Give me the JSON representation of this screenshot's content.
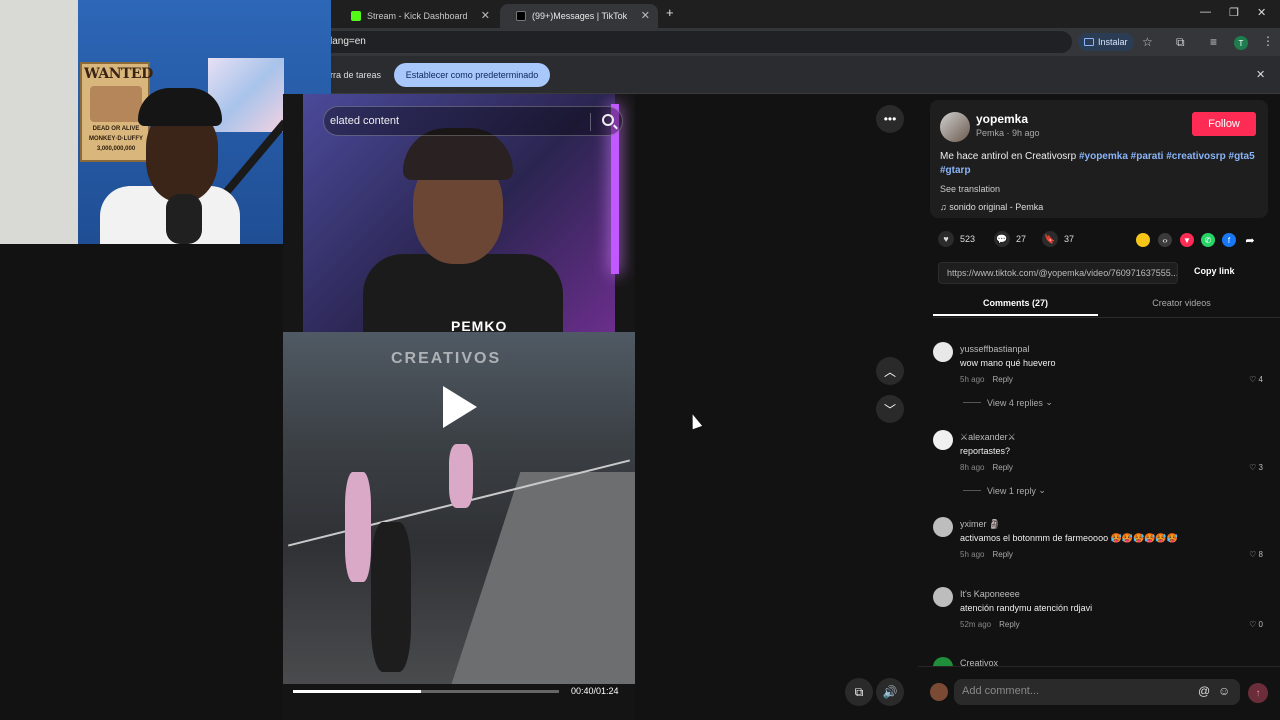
{
  "browser": {
    "tabs": [
      {
        "title": "Stream - Kick Dashboard",
        "favicon_color": "#53fc18"
      },
      {
        "title": "(99+)Messages | TikTok",
        "favicon_color": "#000000"
      }
    ],
    "new_tab": "+",
    "url": "lang=en",
    "install_label": "Instalar",
    "window_controls": [
      "—",
      "❐",
      "✕"
    ]
  },
  "infobar": {
    "text": "rra de tareas",
    "default_button": "Establecer como predeterminado",
    "close": "✕"
  },
  "webcam": {
    "poster_title": "WANTED",
    "poster_line1": "DEAD OR ALIVE",
    "poster_line2": "MONKEY·D·LUFFY",
    "poster_bounty": "3,000,000,000"
  },
  "video": {
    "search_placeholder": "elated content",
    "streamer_brand": "PEMKO",
    "game_logo": "CREATIVOS",
    "time": "00:40/01:24",
    "progress": 0.48
  },
  "post": {
    "username": "yopemka",
    "subline": "Pemka · 9h ago",
    "follow_label": "Follow",
    "description_text": "Me hace antirol en Creativosrp ",
    "hashtags": [
      "#yopemka",
      "#parati",
      "#creativosrp",
      "#gta5",
      "#gtarp"
    ],
    "see_translation": "See translation",
    "sound": "sonido original - Pemka",
    "likes": "523",
    "comments": "27",
    "saves": "37",
    "link": "https://www.tiktok.com/@yopemka/video/760971637555...",
    "copy_link": "Copy link",
    "share_colors": [
      "#f5c518",
      "#3a3a3a",
      "#fe2c55",
      "#25d366",
      "#1877f2"
    ]
  },
  "tabs": {
    "comments": "Comments (27)",
    "creator_videos": "Creator videos"
  },
  "comments": [
    {
      "name": "yusseffbastianpal",
      "text": "wow mano qué huevero",
      "time": "5h ago",
      "reply": "Reply",
      "likes": "4",
      "view_replies": "View 4 replies"
    },
    {
      "name": "⚔alexander⚔",
      "text": "reportastes?",
      "time": "8h ago",
      "reply": "Reply",
      "likes": "3",
      "view_replies": "View 1 reply"
    },
    {
      "name": "yximer 🗿",
      "text": "activamos el botonmm de farmeoooo 🥵🥵🥵🥵🥵🥵",
      "time": "5h ago",
      "reply": "Reply",
      "likes": "8"
    },
    {
      "name": "It's Kaponeeee",
      "text": "atención randymu atención rdjavi",
      "time": "52m ago",
      "reply": "Reply",
      "likes": "0"
    },
    {
      "name": "Creativox"
    }
  ],
  "add_comment_placeholder": "Add comment..."
}
